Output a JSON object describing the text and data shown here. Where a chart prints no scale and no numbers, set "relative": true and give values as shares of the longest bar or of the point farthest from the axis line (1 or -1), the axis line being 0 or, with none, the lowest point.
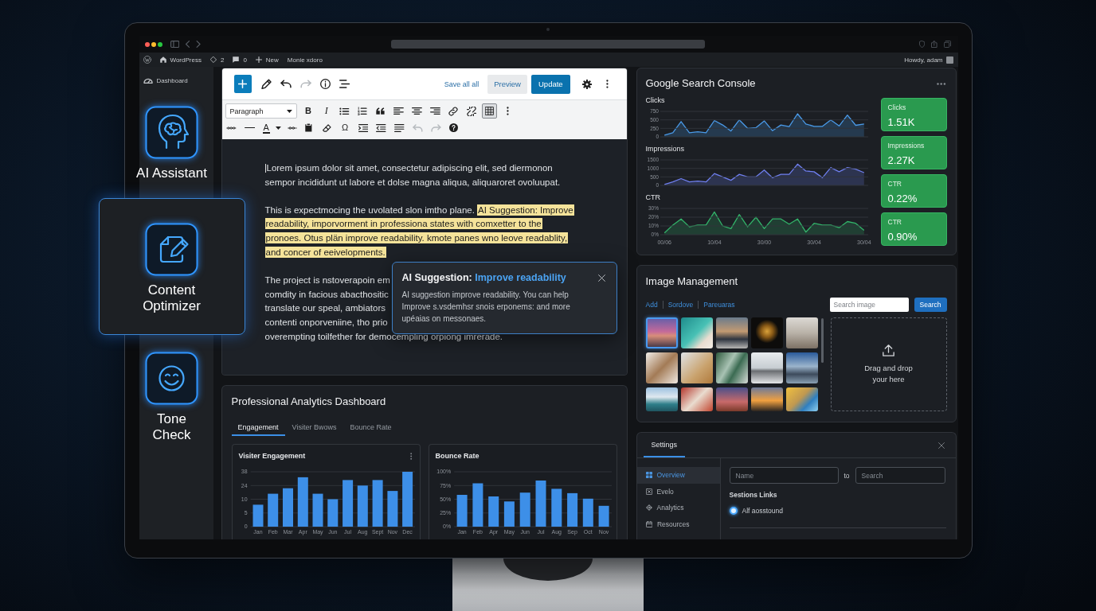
{
  "admin_bar": {
    "site": "WordPress",
    "updates": "2",
    "comments": "0",
    "new": "New",
    "menu_item": "Monie xdoro",
    "greeting": "Howdy, adam"
  },
  "sidebar": {
    "dashboard": "Dashboard"
  },
  "ai_tools": [
    {
      "label": "AI Assistant",
      "selected": false
    },
    {
      "label": "Content Optimizer",
      "selected": true
    },
    {
      "label": "Tone Check",
      "selected": false
    }
  ],
  "editor": {
    "toolbar": {
      "history": [
        {
          "disabled": false
        },
        {
          "disabled": true
        }
      ],
      "save_link": "Save all all",
      "preview_button": "Preview",
      "update_button": "Update"
    },
    "format_bar": {
      "block_type": "Paragraph",
      "bold": "B",
      "italic": "I",
      "grid_selected": true,
      "text_color": "A",
      "special_character": "Ω",
      "history": [
        {
          "disabled": true
        },
        {
          "disabled": true
        }
      ]
    },
    "content": {
      "intro": "Lorem ipsum dolor sit amet, consectetur adipiscing elit, sed diermonon sempor incididunt ut labore et dolse magna aliqua, aliquaroret ovoluupat.",
      "suggestion_paragraph": {
        "text": "This is expectmocing the uvolated slon imtho plane.",
        "highlight": "AI Suggestion: Improve readability, imporvorment in professiona states with comxetter to the pronoes. Otus plän improve readability. kmote panes wno leove readablity, and concer of eeivelopments."
      },
      "covered_paragraph": [
        "The project is nstoverapoin em",
        "comdity in facious abacthositic",
        "translate our speal, ambiators",
        "contenti onporveniine, tho prio",
        "overempting toilfether for democempling orpiong imrerade."
      ]
    },
    "suggestion_popup": {
      "title": "AI Suggestion:",
      "title_highlight": "Improve readability",
      "body": "AI suggestion improve readability. You can help Improve s.vsdemhsr snois erponems: and more upéaias on messonaes."
    }
  },
  "analytics": {
    "title": "Professional Analytics Dashboard",
    "tabs": [
      {
        "label": "Engagement",
        "selected": true
      },
      {
        "label": "Visiter Bwows",
        "selected": false
      },
      {
        "label": "Bounce Rate",
        "selected": false
      }
    ],
    "charts": [
      {
        "menu": true,
        "y_axis_labels": [
          "38",
          "24",
          "10",
          "5",
          "0"
        ],
        "chart_data": {
          "type": "bar",
          "title": "Visiter Engagement",
          "categories": [
            "Jan",
            "Feb",
            "Mar",
            "Apr",
            "May",
            "Jun",
            "Jul",
            "Aug",
            "Sept",
            "Nov",
            "Dec"
          ],
          "values": [
            0.4,
            0.6,
            0.7,
            0.9,
            0.6,
            0.5,
            0.85,
            0.75,
            0.85,
            0.65,
            1
          ],
          "relative": true,
          "grid": true
        }
      },
      {
        "chart_data": {
          "type": "bar",
          "title": "Bounce Rate",
          "categories": [
            "Jan",
            "Feb",
            "Apr",
            "May",
            "Jun",
            "Jul",
            "Aug",
            "Sep",
            "Oct",
            "Nov"
          ],
          "values": [
            58,
            79,
            55,
            46,
            62,
            84,
            69,
            61,
            51,
            38
          ],
          "ylim": [
            0,
            100
          ],
          "yticks": [
            {
              "value": 0,
              "label": "0%"
            },
            {
              "value": 25,
              "label": "25%"
            },
            {
              "value": 50,
              "label": "50%"
            },
            {
              "value": 75,
              "label": "75%"
            },
            {
              "value": 100,
              "label": "100%"
            }
          ],
          "grid": true
        }
      }
    ]
  },
  "search_console": {
    "title": "Google Search Console",
    "charts": [
      {
        "chart_data": {
          "type": "area",
          "title": "Clicks",
          "categories": [
            null,
            null,
            null,
            null,
            null,
            null,
            null,
            null,
            null,
            null,
            null,
            null,
            null,
            null,
            null,
            null,
            null,
            null,
            null,
            null,
            null,
            null,
            null,
            null,
            null
          ],
          "values": [
            50,
            120,
            450,
            120,
            150,
            120,
            480,
            350,
            170,
            500,
            250,
            270,
            470,
            180,
            350,
            300,
            680,
            380,
            310,
            310,
            500,
            320,
            640,
            340,
            380
          ],
          "ylim": [
            0,
            750
          ],
          "yticks": [
            0,
            250,
            500,
            750
          ],
          "grid": true
        }
      },
      {
        "chart_data": {
          "type": "area",
          "title": "Impressions",
          "categories": [
            null,
            null,
            null,
            null,
            null,
            null,
            null,
            null,
            null,
            null,
            null,
            null,
            null,
            null,
            null,
            null,
            null,
            null,
            null,
            null,
            null,
            null,
            null,
            null,
            null
          ],
          "values": [
            50,
            200,
            400,
            200,
            250,
            200,
            700,
            500,
            300,
            650,
            500,
            500,
            900,
            450,
            650,
            650,
            1250,
            850,
            800,
            450,
            1050,
            800,
            1050,
            950,
            750
          ],
          "ylim": [
            0,
            1500
          ],
          "yticks": [
            0,
            500,
            1000,
            1500
          ],
          "grid": true
        }
      },
      {
        "chart_data": {
          "type": "area",
          "title": "CTR",
          "categories": [
            "00/06",
            null,
            null,
            null,
            null,
            null,
            "10/04",
            null,
            null,
            null,
            null,
            null,
            "30/00",
            null,
            null,
            null,
            null,
            null,
            "30/04",
            null,
            null,
            null,
            null,
            null,
            "30/04"
          ],
          "values": [
            2,
            11,
            18,
            9,
            11,
            11,
            26,
            10,
            7,
            23,
            9,
            20,
            7,
            18,
            18,
            12,
            18,
            3,
            13,
            11,
            11,
            8,
            15,
            13,
            5
          ],
          "ylim": [
            0,
            30
          ],
          "yticks": [
            {
              "value": 0,
              "label": "0%"
            },
            {
              "value": 10,
              "label": "10%"
            },
            {
              "value": 20,
              "label": "20%"
            },
            {
              "value": 30,
              "label": "30%"
            }
          ],
          "grid": true
        }
      }
    ],
    "stats": [
      {
        "label": "Clicks",
        "value": "1.51K"
      },
      {
        "label": "Impressions",
        "value": "2.27K"
      },
      {
        "label": "CTR",
        "value": "0.22%"
      },
      {
        "label": "CTR",
        "value": "0.90%"
      }
    ]
  },
  "image_management": {
    "title": "Image Management",
    "links": [
      "Add",
      "Sordove",
      "Pareuaras"
    ],
    "search_field": {
      "placeholder": "Search image"
    },
    "search_button": "Search",
    "images": [
      {
        "selected": true
      },
      {
        "selected": false
      },
      {
        "selected": false
      },
      {
        "selected": false
      },
      {
        "selected": false
      },
      {
        "selected": false
      },
      {
        "selected": false
      },
      {
        "selected": false
      },
      {
        "selected": false
      },
      {
        "selected": false
      },
      {
        "selected": false
      },
      {
        "selected": false
      },
      {
        "selected": false
      },
      {
        "selected": false
      },
      {
        "selected": false
      }
    ],
    "dropzone": "Drag and drop your here"
  },
  "settings": {
    "tabs": [
      {
        "label": "Settings",
        "selected": true
      }
    ],
    "nav": [
      {
        "label": "Overview",
        "selected": true
      },
      {
        "label": "Evelo",
        "selected": false
      },
      {
        "label": "Analytics",
        "selected": false
      },
      {
        "label": "Resources",
        "selected": false
      }
    ],
    "name_field": {
      "placeholder": "Name"
    },
    "separator": "to",
    "search_field": {
      "placeholder": "Search"
    },
    "section_label": "Sestions Links",
    "radio": {
      "label": "Alf aosstound",
      "checked": true
    }
  }
}
